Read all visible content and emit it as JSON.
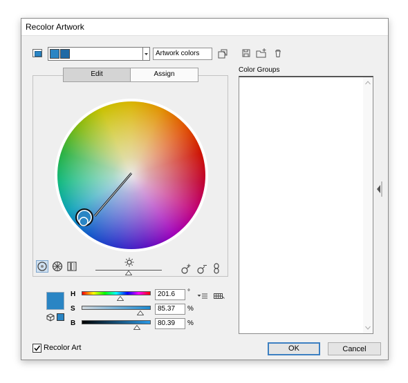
{
  "window": {
    "title": "Recolor Artwork"
  },
  "toolbar": {
    "harmony_dropdown_label": "Artwork colors"
  },
  "tabs": [
    {
      "label": "Edit"
    },
    {
      "label": "Assign"
    }
  ],
  "color_groups": {
    "label": "Color Groups"
  },
  "sliders": [
    {
      "label": "H",
      "value": "201.6",
      "unit": "°",
      "fraction": 0.56
    },
    {
      "label": "S",
      "value": "85.37",
      "unit": "%",
      "fraction": 0.85
    },
    {
      "label": "B",
      "value": "80.39",
      "unit": "%",
      "fraction": 0.8
    }
  ],
  "brightness_fraction": 0.5,
  "recolor_art": {
    "label": "Recolor Art",
    "checked": true
  },
  "buttons": {
    "ok": "OK",
    "cancel": "Cancel"
  },
  "colors": {
    "selected": "#2a85c4",
    "accent": "#3c7fc1"
  },
  "icons": {
    "new_group_from_artwork": "new-group-icon",
    "save": "save-icon",
    "new_folder": "new-folder-icon",
    "delete": "delete-icon",
    "smooth_wheel": "smooth-wheel-icon",
    "segmented_wheel": "segmented-wheel-icon",
    "color_bars": "color-bars-icon",
    "brightness": "sun-icon",
    "add_color": "add-color-icon",
    "remove_color": "remove-color-icon",
    "link_colors": "link-icon",
    "color_mode_menu": "menu-icon",
    "limit_swatch": "swatch-library-icon",
    "collapse_panel": "collapse-arrow-icon",
    "scroll_up": "scroll-up-icon",
    "scroll_down": "scroll-down-icon"
  }
}
